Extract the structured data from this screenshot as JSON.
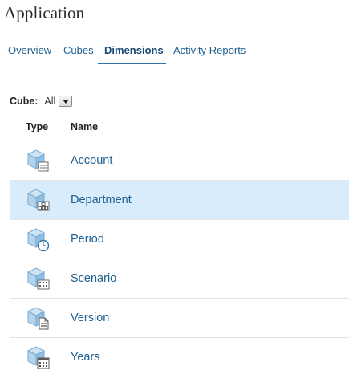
{
  "page": {
    "title": "Application"
  },
  "tabs": [
    {
      "before": "",
      "mnemonic": "O",
      "after": "verview",
      "active": false
    },
    {
      "before": "C",
      "mnemonic": "u",
      "after": "bes",
      "active": false
    },
    {
      "before": "Di",
      "mnemonic": "m",
      "after": "ensions",
      "active": true
    },
    {
      "before": "Activity Reports",
      "mnemonic": "",
      "after": "",
      "active": false
    }
  ],
  "filter": {
    "label": "Cube:",
    "value": "All"
  },
  "table": {
    "headers": {
      "type": "Type",
      "name": "Name"
    },
    "rows": [
      {
        "name": "Account",
        "icon": "account-dimension-icon",
        "selected": false
      },
      {
        "name": "Department",
        "icon": "department-dimension-icon",
        "selected": true
      },
      {
        "name": "Period",
        "icon": "period-dimension-icon",
        "selected": false
      },
      {
        "name": "Scenario",
        "icon": "scenario-dimension-icon",
        "selected": false
      },
      {
        "name": "Version",
        "icon": "version-dimension-icon",
        "selected": false
      },
      {
        "name": "Years",
        "icon": "years-dimension-icon",
        "selected": false
      }
    ]
  },
  "colors": {
    "link": "#1f5e8f",
    "active_tab_underline": "#2d74ae",
    "selected_row": "#d8ecfb",
    "cube_icon": "#9cc6e3"
  }
}
